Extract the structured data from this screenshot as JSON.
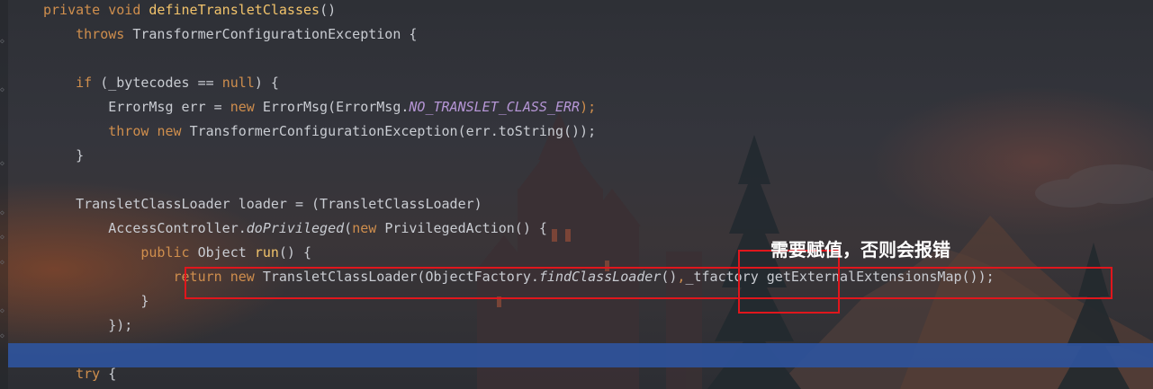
{
  "code_lines": [
    {
      "indent": "",
      "parts": [
        {
          "t": "private ",
          "c": "kw"
        },
        {
          "t": "void ",
          "c": "kw"
        },
        {
          "t": "defineTransletClasses",
          "c": "fn"
        },
        {
          "t": "()",
          "c": ""
        }
      ]
    },
    {
      "indent": "    ",
      "parts": [
        {
          "t": "throws ",
          "c": "kw"
        },
        {
          "t": "TransformerConfigurationException {",
          "c": ""
        }
      ]
    },
    {
      "indent": "",
      "parts": []
    },
    {
      "indent": "    ",
      "parts": [
        {
          "t": "if ",
          "c": "kw"
        },
        {
          "t": "(_bytecodes == ",
          "c": ""
        },
        {
          "t": "null",
          "c": "kw"
        },
        {
          "t": ") {",
          "c": ""
        }
      ]
    },
    {
      "indent": "        ",
      "parts": [
        {
          "t": "ErrorMsg err = ",
          "c": ""
        },
        {
          "t": "new ",
          "c": "kw"
        },
        {
          "t": "ErrorMsg(ErrorMsg.",
          "c": ""
        },
        {
          "t": "NO_TRANSLET_CLASS_ERR",
          "c": "fld"
        },
        {
          "t": ");",
          "c": "kw"
        }
      ]
    },
    {
      "indent": "        ",
      "parts": [
        {
          "t": "throw ",
          "c": "kw"
        },
        {
          "t": "new ",
          "c": "kw"
        },
        {
          "t": "TransformerConfigurationException(err.toString());",
          "c": ""
        }
      ]
    },
    {
      "indent": "    ",
      "parts": [
        {
          "t": "}",
          "c": ""
        }
      ]
    },
    {
      "indent": "",
      "parts": []
    },
    {
      "indent": "    ",
      "parts": [
        {
          "t": "TransletClassLoader loader = (TransletClassLoader)",
          "c": ""
        }
      ]
    },
    {
      "indent": "        ",
      "parts": [
        {
          "t": "AccessController.",
          "c": ""
        },
        {
          "t": "doPrivileged",
          "c": "it"
        },
        {
          "t": "(",
          "c": ""
        },
        {
          "t": "new ",
          "c": "kw"
        },
        {
          "t": "PrivilegedAction() {",
          "c": ""
        }
      ]
    },
    {
      "indent": "            ",
      "parts": [
        {
          "t": "public ",
          "c": "kw"
        },
        {
          "t": "Object ",
          "c": ""
        },
        {
          "t": "run",
          "c": "fn"
        },
        {
          "t": "() {",
          "c": ""
        }
      ]
    },
    {
      "indent": "                ",
      "parts": [
        {
          "t": "return ",
          "c": "kw"
        },
        {
          "t": "new ",
          "c": "kw"
        },
        {
          "t": "TransletClassLoader(ObjectFactory.",
          "c": ""
        },
        {
          "t": "findClassLoader",
          "c": "it"
        },
        {
          "t": "()",
          "c": ""
        },
        {
          "t": ",",
          "c": "kw"
        },
        {
          "t": "_tfactory",
          "c": ""
        },
        {
          "t": " getExternalExtensionsMap());",
          "c": ""
        }
      ]
    },
    {
      "indent": "            ",
      "parts": [
        {
          "t": "}",
          "c": ""
        }
      ]
    },
    {
      "indent": "        ",
      "parts": [
        {
          "t": "});",
          "c": ""
        }
      ]
    },
    {
      "indent": "",
      "parts": []
    },
    {
      "indent": "    ",
      "parts": [
        {
          "t": "try ",
          "c": "kw"
        },
        {
          "t": "{",
          "c": ""
        }
      ]
    }
  ],
  "annotation": {
    "note_text": "需要赋值，否则会报错"
  },
  "colors": {
    "keyword": "#cf8e4d",
    "method": "#f2c36b",
    "constant": "#b696d6",
    "text": "#c9ccd2",
    "annotation_box": "#e0161c",
    "current_line": "#2f549c"
  }
}
